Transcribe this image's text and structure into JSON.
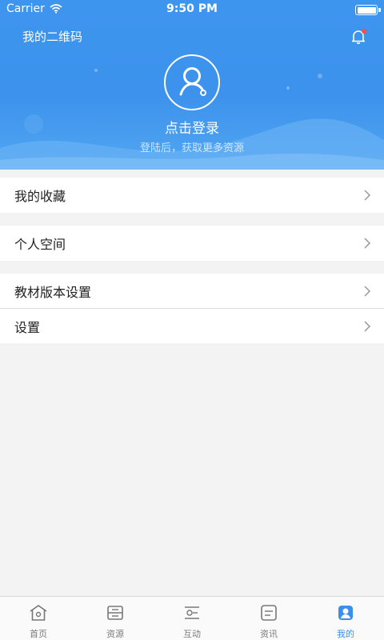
{
  "status_bar": {
    "carrier": "Carrier",
    "time": "9:50 PM"
  },
  "header": {
    "qr_label": "我的二维码",
    "login_title": "点击登录",
    "login_subtitle": "登陆后，获取更多资源"
  },
  "menu": {
    "favorites": "我的收藏",
    "personal_space": "个人空间",
    "textbook_settings": "教材版本设置",
    "settings": "设置"
  },
  "tabs": [
    {
      "label": "首页",
      "icon": "home-icon",
      "active": false
    },
    {
      "label": "资源",
      "icon": "resource-icon",
      "active": false
    },
    {
      "label": "互动",
      "icon": "interaction-icon",
      "active": false
    },
    {
      "label": "资讯",
      "icon": "news-icon",
      "active": false
    },
    {
      "label": "我的",
      "icon": "profile-icon",
      "active": true
    }
  ],
  "colors": {
    "accent": "#3a8fea",
    "header_bg": "#3e95ee",
    "badge": "#ff4d4d"
  }
}
